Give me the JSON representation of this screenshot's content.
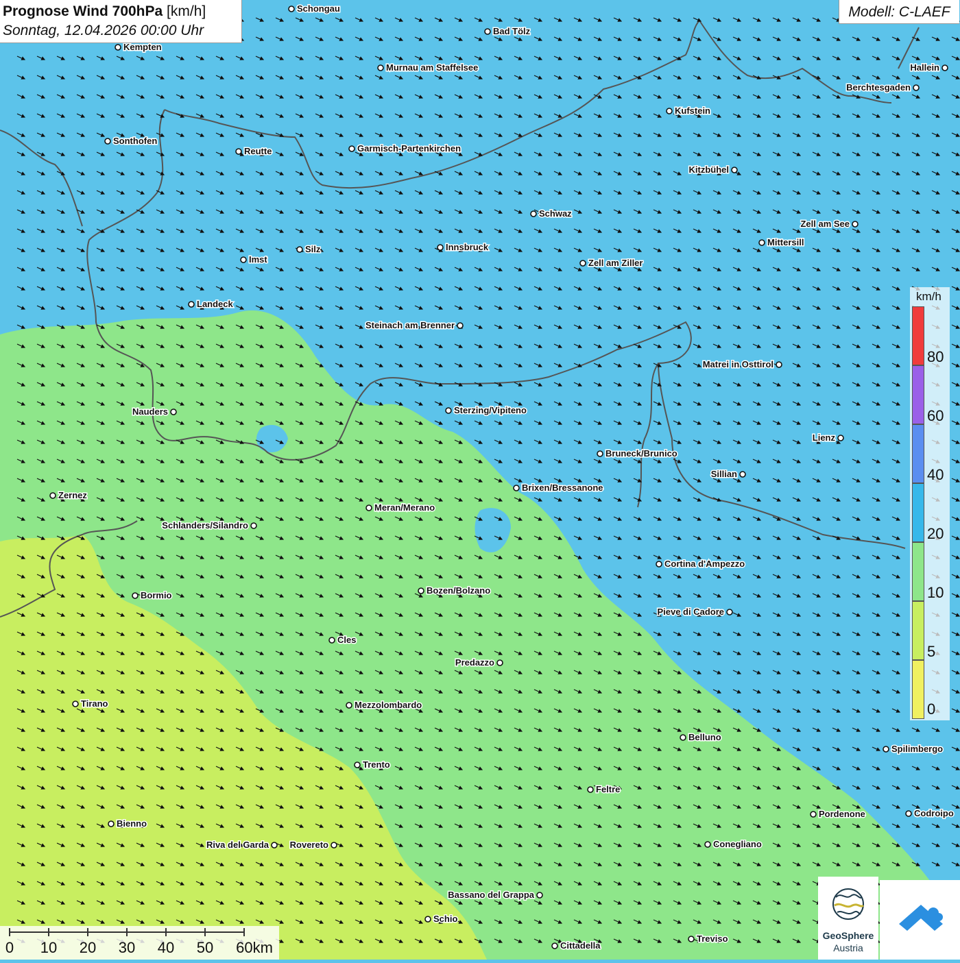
{
  "title": {
    "main": "Prognose Wind 700hPa",
    "unit": "[km/h]",
    "datetime": "Sonntag, 12.04.2026 00:00 Uhr"
  },
  "model": "Modell: C-LAEF",
  "legend": {
    "unit": "km/h",
    "ticks": [
      "0",
      "5",
      "10",
      "20",
      "40",
      "60",
      "80"
    ],
    "colors": [
      "#f0f060",
      "#c8ee60",
      "#8ee68a",
      "#37b8ea",
      "#5a8ef0",
      "#9a60e8",
      "#f03c3c"
    ]
  },
  "scalebar": {
    "labels": [
      "0",
      "10",
      "20",
      "30",
      "40",
      "50",
      "60km"
    ]
  },
  "logos": {
    "geosphere_line1": "GeoSphere",
    "geosphere_line2": "Austria"
  },
  "colors": {
    "wind_10_20": "#5cc3ea",
    "wind_5_10": "#8ee68a",
    "wind_0_5": "#c8ee60",
    "border": "#555555"
  },
  "cities": [
    {
      "name": "Schongau"
    },
    {
      "name": "Bad Tölz"
    },
    {
      "name": "Kempten"
    },
    {
      "name": "Murnau am Staffelsee"
    },
    {
      "name": "Hallein"
    },
    {
      "name": "Berchtesgaden"
    },
    {
      "name": "Kufstein"
    },
    {
      "name": "Sonthofen"
    },
    {
      "name": "Reutte"
    },
    {
      "name": "Garmisch-Partenkirchen"
    },
    {
      "name": "Kitzbühel"
    },
    {
      "name": "Schwaz"
    },
    {
      "name": "Zell am See"
    },
    {
      "name": "Mittersill"
    },
    {
      "name": "Innsbruck"
    },
    {
      "name": "Silz"
    },
    {
      "name": "Imst"
    },
    {
      "name": "Zell am Ziller"
    },
    {
      "name": "Landeck"
    },
    {
      "name": "Steinach am Brenner"
    },
    {
      "name": "Matrei in Osttirol"
    },
    {
      "name": "Nauders"
    },
    {
      "name": "Sterzing/Vipiteno"
    },
    {
      "name": "Lienz"
    },
    {
      "name": "Bruneck/Brunico"
    },
    {
      "name": "Sillian"
    },
    {
      "name": "Brixen/Bressanone"
    },
    {
      "name": "Zernez"
    },
    {
      "name": "Meran/Merano"
    },
    {
      "name": "Schlanders/Silandro"
    },
    {
      "name": "Cortina d'Ampezzo"
    },
    {
      "name": "Bormio"
    },
    {
      "name": "Bozen/Bolzano"
    },
    {
      "name": "Pieve di Cadore"
    },
    {
      "name": "Cles"
    },
    {
      "name": "Predazzo"
    },
    {
      "name": "Tirano"
    },
    {
      "name": "Mezzolombardo"
    },
    {
      "name": "Belluno"
    },
    {
      "name": "Spilimbergo"
    },
    {
      "name": "Trento"
    },
    {
      "name": "Feltre"
    },
    {
      "name": "Pordenone"
    },
    {
      "name": "Codroipo"
    },
    {
      "name": "Bienno"
    },
    {
      "name": "Riva del Garda"
    },
    {
      "name": "Rovereto"
    },
    {
      "name": "Conegliano"
    },
    {
      "name": "Bassano del Grappa"
    },
    {
      "name": "Schio"
    },
    {
      "name": "Treviso"
    },
    {
      "name": "Cittadella"
    }
  ]
}
